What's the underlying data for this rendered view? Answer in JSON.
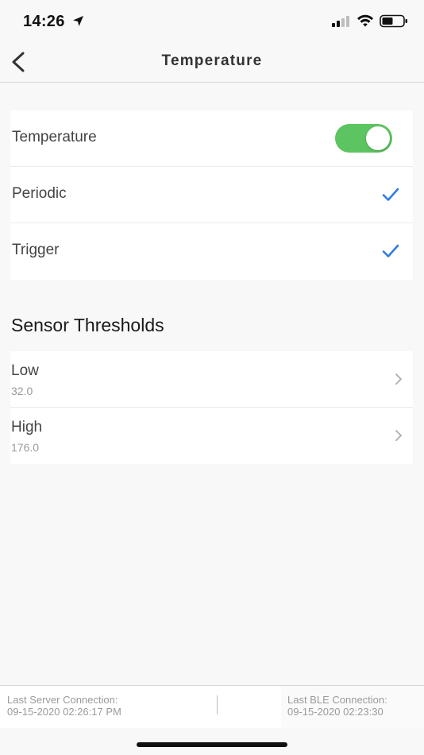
{
  "status_bar": {
    "time": "14:26"
  },
  "nav": {
    "title": "Temperature"
  },
  "settings": {
    "temperature_label": "Temperature",
    "temperature_enabled": true,
    "periodic_label": "Periodic",
    "trigger_label": "Trigger"
  },
  "thresholds": {
    "section_title": "Sensor Thresholds",
    "items": [
      {
        "label": "Low",
        "value": "32.0"
      },
      {
        "label": "High",
        "value": "176.0"
      }
    ]
  },
  "footer": {
    "server_label": "Last Server Connection:",
    "server_time": "09-15-2020 02:26:17 PM",
    "ble_label": "Last BLE Connection:",
    "ble_time": "09-15-2020 02:23:30"
  },
  "colors": {
    "toggle_on": "#5cc460",
    "check": "#2f7de1"
  }
}
